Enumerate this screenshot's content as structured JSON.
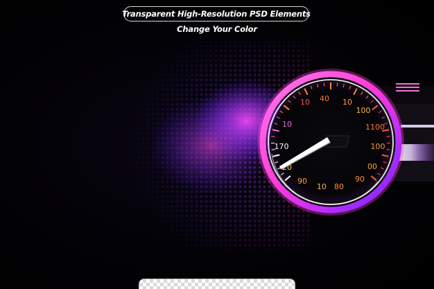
{
  "header": {
    "title": "Transparent High-Resolution PSD Elements",
    "subtitle": "Change Your Color"
  },
  "gauge": {
    "scale_labels": [
      {
        "text": "10",
        "color": "#e86bd8"
      },
      {
        "text": "170",
        "color": "#ffffff"
      },
      {
        "text": "20",
        "color": "#ffd35a"
      },
      {
        "text": "90",
        "color": "#ff9f40"
      },
      {
        "text": "10",
        "color": "#ffb347"
      },
      {
        "text": "80",
        "color": "#ff8c3a"
      },
      {
        "text": "90",
        "color": "#ff8c3a"
      },
      {
        "text": "00",
        "color": "#ff9f40"
      },
      {
        "text": "100",
        "color": "#ff9f40"
      },
      {
        "text": "1100",
        "color": "#ff7a2e"
      },
      {
        "text": "100",
        "color": "#ffb347"
      },
      {
        "text": "10",
        "color": "#ff9f40"
      },
      {
        "text": "40",
        "color": "#ff7a2e"
      },
      {
        "text": "10",
        "color": "#ff5050"
      }
    ],
    "accent_colors": {
      "magenta": "#ff36e6",
      "violet": "#8a2be2",
      "blue": "#3a3cff",
      "orange": "#ff8c3a"
    },
    "needle_icon": "needle-icon"
  }
}
